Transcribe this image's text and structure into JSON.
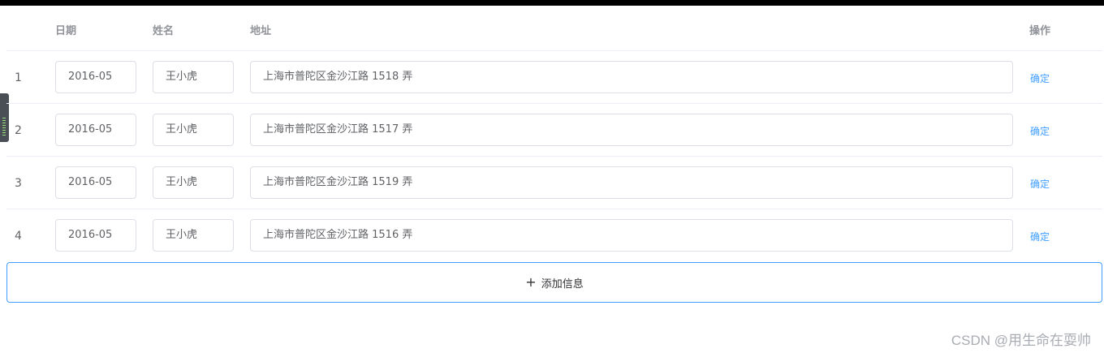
{
  "table": {
    "headers": {
      "date": "日期",
      "name": "姓名",
      "address": "地址",
      "action": "操作"
    },
    "rows": [
      {
        "index": "1",
        "date": "2016-05",
        "name": "王小虎",
        "address": "上海市普陀区金沙江路 1518 弄",
        "action": "确定"
      },
      {
        "index": "2",
        "date": "2016-05",
        "name": "王小虎",
        "address": "上海市普陀区金沙江路 1517 弄",
        "action": "确定"
      },
      {
        "index": "3",
        "date": "2016-05",
        "name": "王小虎",
        "address": "上海市普陀区金沙江路 1519 弄",
        "action": "确定"
      },
      {
        "index": "4",
        "date": "2016-05",
        "name": "王小虎",
        "address": "上海市普陀区金沙江路 1516 弄",
        "action": "确定"
      }
    ]
  },
  "add_button": {
    "icon": "plus-icon",
    "label": "添加信息"
  },
  "watermark": "CSDN @用生命在耍帅",
  "colors": {
    "link": "#409eff",
    "border": "#dcdfe6",
    "header_text": "#909399"
  }
}
